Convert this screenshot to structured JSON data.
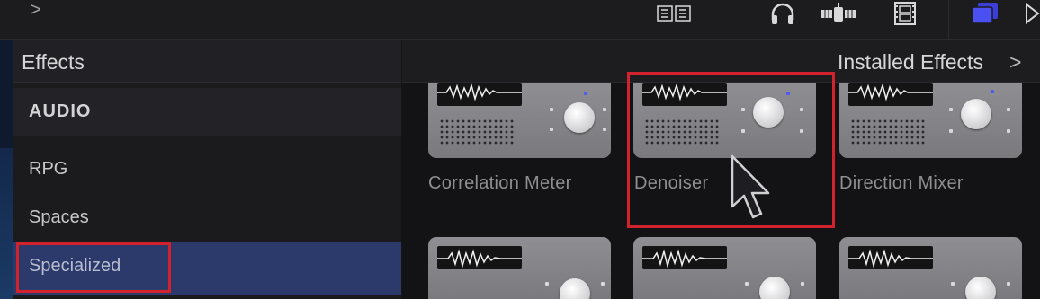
{
  "toolbar": {
    "chevron": ">",
    "icons": [
      "audio-meter-icon",
      "headphones-icon",
      "satellite-icon",
      "film-icon",
      "browser-stack-icon",
      "play-icon"
    ]
  },
  "sidebar": {
    "title": "Effects",
    "items": [
      {
        "label": "AUDIO"
      },
      {
        "label": "RPG"
      },
      {
        "label": "Spaces"
      },
      {
        "label": "Specialized",
        "selected": true
      }
    ]
  },
  "pane": {
    "title": "Installed Effects",
    "chevron": ">"
  },
  "effects": [
    {
      "label": "Correlation Meter"
    },
    {
      "label": "Denoiser",
      "highlighted": true
    },
    {
      "label": "Direction Mixer"
    }
  ],
  "colors": {
    "selection": "#2b3a6a",
    "highlight_outline": "#d2222d",
    "knob_indicator": "#4c5cf0"
  }
}
